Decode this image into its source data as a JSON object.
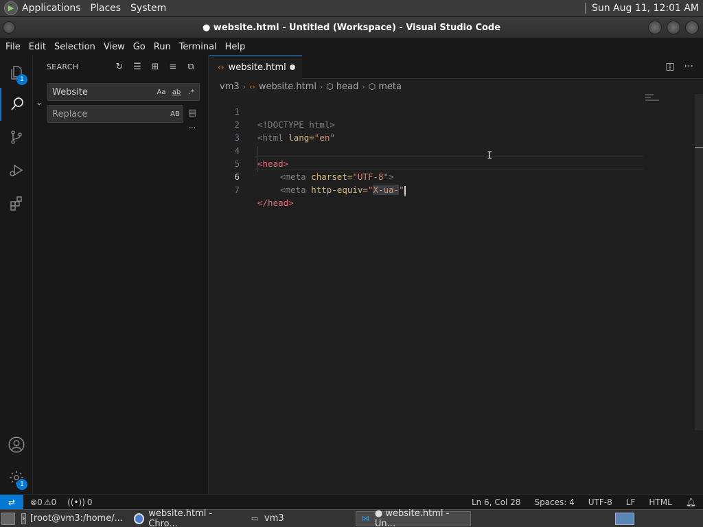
{
  "top_panel": {
    "menus": [
      "Applications",
      "Places",
      "System"
    ],
    "clock": "Sun Aug 11, 12:01 AM"
  },
  "window": {
    "title": "● website.html - Untitled (Workspace) - Visual Studio Code"
  },
  "menubar": [
    "File",
    "Edit",
    "Selection",
    "View",
    "Go",
    "Run",
    "Terminal",
    "Help"
  ],
  "activity_bar": {
    "explorer_badge": "1",
    "settings_badge": "1",
    "accent": "#0078d4"
  },
  "sidebar": {
    "title": "SEARCH",
    "search": {
      "value": "Website",
      "opts": [
        "Aa",
        "ab",
        ".*"
      ]
    },
    "replace": {
      "placeholder": "Replace",
      "opt": "AB"
    },
    "more": "..."
  },
  "tab": {
    "label": "website.html"
  },
  "breadcrumb": [
    "vm3",
    "website.html",
    "head",
    "meta"
  ],
  "editor": {
    "current_line": 6,
    "lines": [
      {
        "n": "1",
        "a": "<!DOCTYPE html>",
        "b": "",
        "c": ""
      },
      {
        "n": "2",
        "a": "<html",
        "b": " lang=",
        "c": "\"en\""
      },
      {
        "n": "3",
        "a": "",
        "b": "",
        "c": ""
      },
      {
        "n": "4",
        "a": "<head>",
        "b": "",
        "c": ""
      },
      {
        "n": "5",
        "a": "<meta",
        "b": " charset=",
        "c": "\"UTF-8\"",
        "d": ">"
      },
      {
        "n": "6",
        "a": "<meta",
        "b": " http-equiv=",
        "c": "\"",
        "sel": "X-ua-",
        "e": "\""
      },
      {
        "n": "7",
        "a": "</head>",
        "b": "",
        "c": ""
      }
    ]
  },
  "statusbar": {
    "errors": "0",
    "warnings": "0",
    "ports": "0",
    "position": "Ln 6, Col 28",
    "spaces": "Spaces: 4",
    "encoding": "UTF-8",
    "eol": "LF",
    "language": "HTML"
  },
  "taskbar": {
    "tasks": [
      "[root@vm3:/home/...",
      "website.html - Chro...",
      "vm3",
      "● website.html - Un..."
    ]
  }
}
